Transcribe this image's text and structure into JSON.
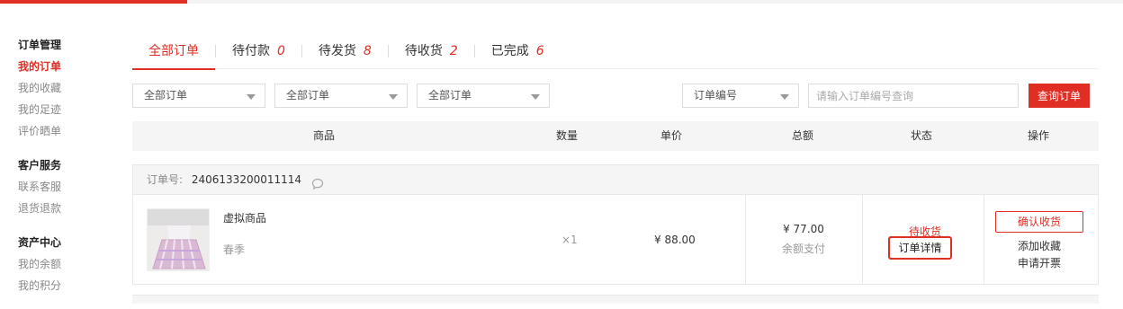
{
  "sidebar": {
    "groups": [
      {
        "title": "订单管理",
        "items": [
          "我的订单",
          "我的收藏",
          "我的足迹",
          "评价晒单"
        ]
      },
      {
        "title": "客户服务",
        "items": [
          "联系客服",
          "退货退款"
        ]
      },
      {
        "title": "资产中心",
        "items": [
          "我的余额",
          "我的积分"
        ]
      }
    ]
  },
  "tabs": [
    {
      "label": "全部订单",
      "count": ""
    },
    {
      "label": "待付款",
      "count": "0"
    },
    {
      "label": "待发货",
      "count": "8"
    },
    {
      "label": "待收货",
      "count": "2"
    },
    {
      "label": "已完成",
      "count": "6"
    }
  ],
  "filters": {
    "select1": "全部订单",
    "select2": "全部订单",
    "select3": "全部订单",
    "search_type": "订单编号",
    "search_placeholder": "请输入订单编号查询",
    "search_button": "查询订单"
  },
  "table_headers": {
    "product": "商品",
    "quantity": "数量",
    "unit_price": "单价",
    "total": "总额",
    "status": "状态",
    "actions": "操作"
  },
  "order": {
    "number_label": "订单号:",
    "number": "2406133200011114",
    "product_name": "虚拟商品",
    "product_spec": "春季",
    "quantity": "×1",
    "unit_price": "¥ 88.00",
    "total": "¥ 77.00",
    "payment_method": "余额支付",
    "status": "待收货",
    "detail_link": "订单详情",
    "confirm_button": "确认收货",
    "favorite_link": "添加收藏",
    "invoice_link": "申请开票"
  },
  "colors": {
    "accent": "#e02e24"
  }
}
